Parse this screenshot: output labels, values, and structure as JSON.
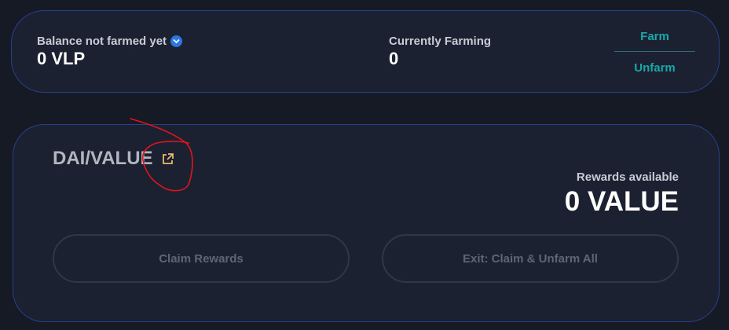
{
  "balance": {
    "label": "Balance not farmed yet",
    "value": "0 VLP",
    "icon": "chevron-down-icon"
  },
  "farming": {
    "label": "Currently Farming",
    "value": "0"
  },
  "actions": {
    "farm": "Farm",
    "unfarm": "Unfarm"
  },
  "pool": {
    "name": "DAI/VALUE",
    "link_icon": "external-link-icon",
    "rewards_label": "Rewards available",
    "rewards_value": "0 VALUE",
    "claim_label": "Claim Rewards",
    "exit_label": "Exit: Claim & Unfarm All"
  },
  "colors": {
    "background": "#161a24",
    "card": "#1c2131",
    "card_border": "#27408c",
    "accent_teal": "#19a8a8",
    "link_icon": "#e8b96a",
    "annotation": "#e0141e"
  }
}
